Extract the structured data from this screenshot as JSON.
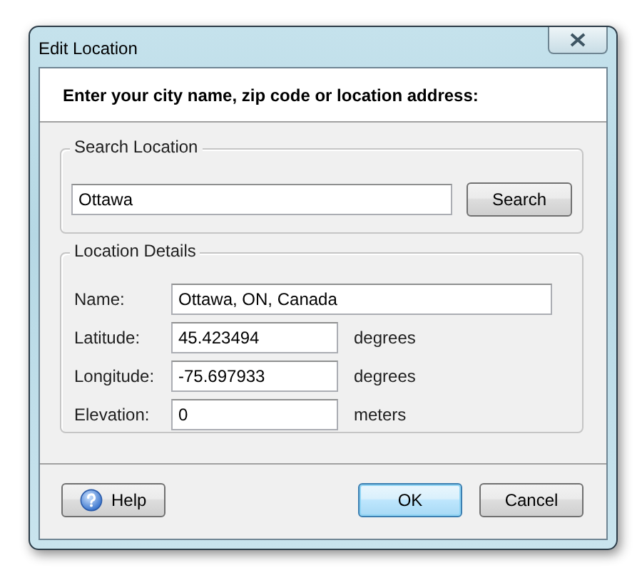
{
  "window": {
    "title": "Edit Location"
  },
  "instruction": "Enter your city name, zip code or location address:",
  "search_group": {
    "title": "Search Location",
    "field": {
      "value": "Ottawa"
    },
    "button": "Search"
  },
  "details_group": {
    "title": "Location Details",
    "fields": [
      {
        "label": "Name:",
        "value": "Ottawa, ON, Canada",
        "kind": "wide"
      },
      {
        "label": "Latitude:",
        "value": "45.423494",
        "unit": "degrees",
        "kind": "unit"
      },
      {
        "label": "Longitude:",
        "value": "-75.697933",
        "unit": "degrees",
        "kind": "unit"
      },
      {
        "label": "Elevation:",
        "value": "0",
        "unit": "meters",
        "kind": "unit"
      }
    ]
  },
  "buttons": [
    {
      "label": "Help",
      "kind": "help",
      "default": false
    },
    {
      "label": "OK",
      "kind": "plain",
      "default": true
    },
    {
      "label": "Cancel",
      "kind": "plain",
      "default": false
    }
  ]
}
